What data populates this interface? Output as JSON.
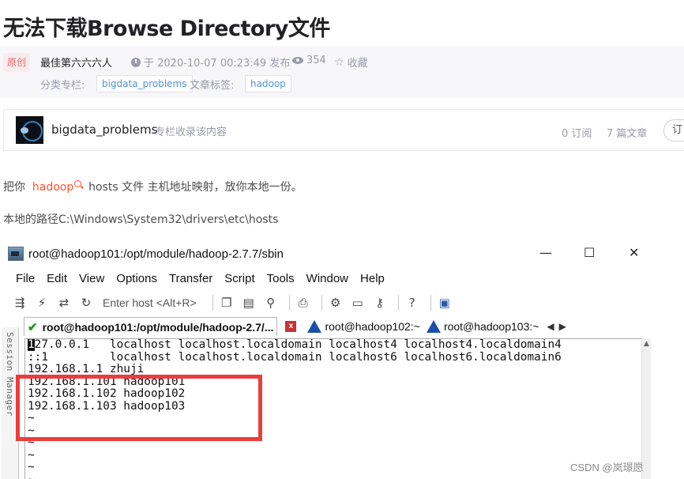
{
  "article": {
    "title": "无法下载Browse Directory文件",
    "badge": "原创",
    "author": "最佳第六六六人",
    "publish": "于 2020-10-07 00:23:49 发布",
    "views": "354",
    "favorite": "收藏",
    "category_label": "分类专栏:",
    "category_tag": "bigdata_problems",
    "tag_label": "文章标签:",
    "tag": "hadoop"
  },
  "column": {
    "name": "bigdata_problems",
    "desc": "专栏收录该内容",
    "subscribers": "0 订阅",
    "articles": "7 篇文章",
    "subscribe": "订"
  },
  "body": {
    "p1_before": "把你",
    "p1_keyword": "hadoop",
    "p1_after": "hosts 文件 主机地址映射，放你本地一份。",
    "p2": "本地的路径C:\\Windows\\System32\\drivers\\etc\\hosts"
  },
  "terminal_window": {
    "title": "root@hadoop101:/opt/module/hadoop-2.7.7/sbin",
    "controls": [
      "—",
      "☐",
      "✕"
    ],
    "menu": [
      "File",
      "Edit",
      "View",
      "Options",
      "Transfer",
      "Script",
      "Tools",
      "Window",
      "Help"
    ],
    "host_placeholder": "Enter host <Alt+R>",
    "tabs": [
      {
        "label": "root@hadoop101:/opt/module/hadoop-2.7/..."
      },
      {
        "label": "root@hadoop102:~"
      },
      {
        "label": "root@hadoop103:~"
      }
    ],
    "session_manager": "Session Manager",
    "lines": [
      "127.0.0.1   localhost localhost.localdomain localhost4 localhost4.localdomain4",
      "::1         localhost localhost.localdomain localhost6 localhost6.localdomain6",
      "192.168.1.1 zhuji",
      "192.168.1.101 hadoop101",
      "192.168.1.102 hadoop102",
      "192.168.1.103 hadoop103",
      "~",
      "~",
      "~",
      "~",
      "~",
      "~"
    ]
  },
  "watermark": "CSDN @岚璟愿",
  "colors": {
    "keyword": "#fc5531",
    "tag_text": "#5094d5",
    "highlight_box": "#ea3d3d"
  }
}
